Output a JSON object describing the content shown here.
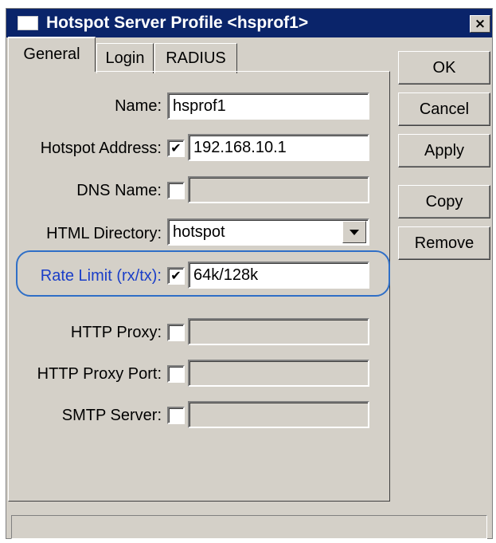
{
  "window": {
    "title": "Hotspot Server Profile <hsprof1>",
    "close_symbol": "×"
  },
  "tabs": [
    {
      "label": "General",
      "active": true
    },
    {
      "label": "Login",
      "active": false
    },
    {
      "label": "RADIUS",
      "active": false
    }
  ],
  "form": {
    "name": {
      "label": "Name:",
      "value": "hsprof1"
    },
    "hotspot_address": {
      "label": "Hotspot Address:",
      "checked": true,
      "value": "192.168.10.1"
    },
    "dns_name": {
      "label": "DNS Name:",
      "checked": false,
      "value": ""
    },
    "html_directory": {
      "label": "HTML Directory:",
      "value": "hotspot"
    },
    "rate_limit": {
      "label": "Rate Limit (rx/tx):",
      "checked": true,
      "value": "64k/128k"
    },
    "http_proxy": {
      "label": "HTTP Proxy:",
      "checked": false,
      "value": ""
    },
    "http_proxy_port": {
      "label": "HTTP Proxy Port:",
      "checked": false,
      "value": ""
    },
    "smtp_server": {
      "label": "SMTP Server:",
      "checked": false,
      "value": ""
    }
  },
  "buttons": {
    "ok": "OK",
    "cancel": "Cancel",
    "apply": "Apply",
    "copy": "Copy",
    "remove": "Remove"
  },
  "checkmark": "✔",
  "colors": {
    "titlebar": "#0a246a",
    "highlight_label": "#1a3ec8",
    "highlight_ring": "#2f6fc7"
  },
  "icons": {
    "window": "window-icon",
    "close": "close-icon",
    "dropdown": "chevron-down-icon"
  }
}
